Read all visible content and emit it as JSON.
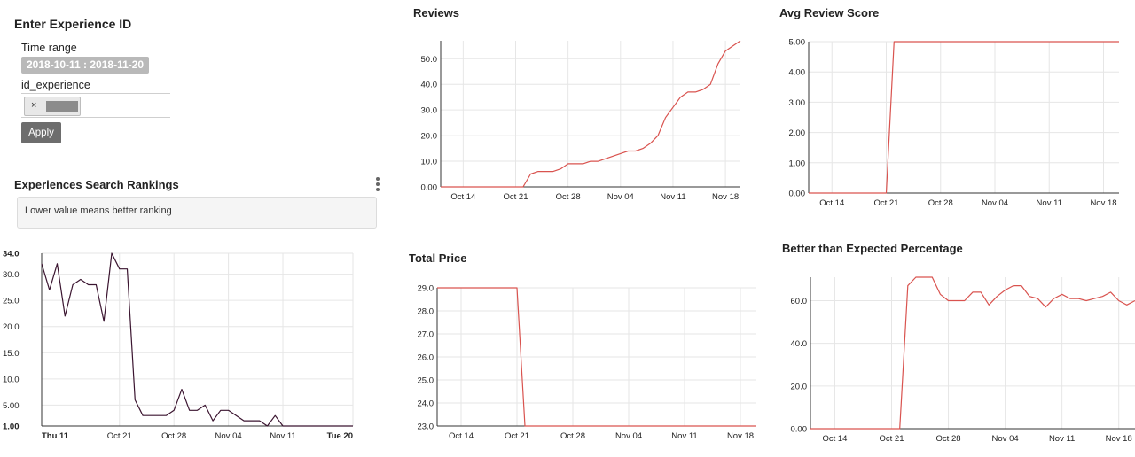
{
  "filters": {
    "title": "Enter Experience ID",
    "time_range_label": "Time range",
    "time_range_value": "2018-10-11 : 2018-11-20",
    "id_label": "id_experience",
    "tag_remove": "×",
    "apply_label": "Apply"
  },
  "rankings": {
    "title": "Experiences Search Rankings",
    "note": "Lower value means better ranking"
  },
  "titles": {
    "reviews": "Reviews",
    "avg_score": "Avg Review Score",
    "total_price": "Total Price",
    "better": "Better than Expected Percentage"
  },
  "colors": {
    "series_red": "#d9534f",
    "series_dark": "#3b1530",
    "grid": "#e6e6e6"
  },
  "chart_data": [
    {
      "id": "rankings",
      "type": "line",
      "x_ticks": [
        "Thu 11",
        "Oct 21",
        "Oct 28",
        "Nov 04",
        "Nov 11",
        "Tue 20"
      ],
      "y_ticks": [
        "1.00",
        "5.00",
        "10.0",
        "15.0",
        "20.0",
        "25.0",
        "30.0",
        "34.0"
      ],
      "ylim": [
        1,
        34
      ],
      "x": [
        "2018-10-11",
        "2018-10-12",
        "2018-10-13",
        "2018-10-14",
        "2018-10-15",
        "2018-10-16",
        "2018-10-17",
        "2018-10-18",
        "2018-10-19",
        "2018-10-20",
        "2018-10-21",
        "2018-10-22",
        "2018-10-23",
        "2018-10-24",
        "2018-10-25",
        "2018-10-26",
        "2018-10-27",
        "2018-10-28",
        "2018-10-29",
        "2018-10-30",
        "2018-10-31",
        "2018-11-01",
        "2018-11-02",
        "2018-11-03",
        "2018-11-04",
        "2018-11-05",
        "2018-11-06",
        "2018-11-07",
        "2018-11-08",
        "2018-11-09",
        "2018-11-10",
        "2018-11-11",
        "2018-11-12",
        "2018-11-13",
        "2018-11-14",
        "2018-11-15",
        "2018-11-16",
        "2018-11-17",
        "2018-11-18",
        "2018-11-19",
        "2018-11-20"
      ],
      "values": [
        32,
        27,
        32,
        22,
        28,
        29,
        28,
        28,
        21,
        34,
        31,
        31,
        6,
        3,
        3,
        3,
        3,
        4,
        8,
        4,
        4,
        5,
        2,
        4,
        4,
        3,
        2,
        2,
        2,
        1,
        3,
        1,
        1,
        1,
        1,
        1,
        1,
        1,
        1,
        1,
        1
      ],
      "color": "#3b1530"
    },
    {
      "id": "reviews",
      "type": "line",
      "x_ticks": [
        "Oct 14",
        "Oct 21",
        "Oct 28",
        "Nov 04",
        "Nov 11",
        "Nov 18"
      ],
      "y_ticks": [
        "0.00",
        "10.0",
        "20.0",
        "30.0",
        "40.0",
        "50.0"
      ],
      "ylim": [
        0,
        57
      ],
      "x": [
        "2018-10-11",
        "2018-10-12",
        "2018-10-13",
        "2018-10-14",
        "2018-10-15",
        "2018-10-16",
        "2018-10-17",
        "2018-10-18",
        "2018-10-19",
        "2018-10-20",
        "2018-10-21",
        "2018-10-22",
        "2018-10-23",
        "2018-10-24",
        "2018-10-25",
        "2018-10-26",
        "2018-10-27",
        "2018-10-28",
        "2018-10-29",
        "2018-10-30",
        "2018-10-31",
        "2018-11-01",
        "2018-11-02",
        "2018-11-03",
        "2018-11-04",
        "2018-11-05",
        "2018-11-06",
        "2018-11-07",
        "2018-11-08",
        "2018-11-09",
        "2018-11-10",
        "2018-11-11",
        "2018-11-12",
        "2018-11-13",
        "2018-11-14",
        "2018-11-15",
        "2018-11-16",
        "2018-11-17",
        "2018-11-18",
        "2018-11-19",
        "2018-11-20"
      ],
      "values": [
        0,
        0,
        0,
        0,
        0,
        0,
        0,
        0,
        0,
        0,
        0,
        0,
        5,
        6,
        6,
        6,
        7,
        9,
        9,
        9,
        10,
        10,
        11,
        12,
        13,
        14,
        14,
        15,
        17,
        20,
        27,
        31,
        35,
        37,
        37,
        38,
        40,
        48,
        53,
        55,
        57
      ],
      "color": "#d9534f"
    },
    {
      "id": "avg_score",
      "type": "line",
      "x_ticks": [
        "Oct 14",
        "Oct 21",
        "Oct 28",
        "Nov 04",
        "Nov 11",
        "Nov 18"
      ],
      "y_ticks": [
        "0.00",
        "1.00",
        "2.00",
        "3.00",
        "4.00",
        "5.00"
      ],
      "ylim": [
        0,
        5
      ],
      "x": [
        "2018-10-11",
        "2018-10-21",
        "2018-10-22",
        "2018-11-20"
      ],
      "values": [
        0,
        0,
        5,
        5
      ],
      "color": "#d9534f"
    },
    {
      "id": "total_price",
      "type": "line",
      "x_ticks": [
        "Oct 14",
        "Oct 21",
        "Oct 28",
        "Nov 04",
        "Nov 11",
        "Nov 18"
      ],
      "y_ticks": [
        "23.0",
        "24.0",
        "25.0",
        "26.0",
        "27.0",
        "28.0",
        "29.0"
      ],
      "ylim": [
        23,
        29
      ],
      "x": [
        "2018-10-11",
        "2018-10-21",
        "2018-10-22",
        "2018-11-20"
      ],
      "values": [
        29,
        29,
        23,
        23
      ],
      "color": "#d9534f"
    },
    {
      "id": "better",
      "type": "line",
      "x_ticks": [
        "Oct 14",
        "Oct 21",
        "Oct 28",
        "Nov 04",
        "Nov 11",
        "Nov 18"
      ],
      "y_ticks": [
        "0.00",
        "20.0",
        "40.0",
        "60.0"
      ],
      "ylim": [
        0,
        71
      ],
      "x": [
        "2018-10-11",
        "2018-10-22",
        "2018-10-23",
        "2018-10-24",
        "2018-10-25",
        "2018-10-26",
        "2018-10-27",
        "2018-10-28",
        "2018-10-29",
        "2018-10-30",
        "2018-10-31",
        "2018-11-01",
        "2018-11-02",
        "2018-11-03",
        "2018-11-04",
        "2018-11-05",
        "2018-11-06",
        "2018-11-07",
        "2018-11-08",
        "2018-11-09",
        "2018-11-10",
        "2018-11-11",
        "2018-11-12",
        "2018-11-13",
        "2018-11-14",
        "2018-11-15",
        "2018-11-16",
        "2018-11-17",
        "2018-11-18",
        "2018-11-19",
        "2018-11-20"
      ],
      "values": [
        0,
        0,
        67,
        71,
        71,
        71,
        63,
        60,
        60,
        60,
        64,
        64,
        58,
        62,
        65,
        67,
        67,
        62,
        61,
        57,
        61,
        63,
        61,
        61,
        60,
        61,
        62,
        64,
        60,
        58,
        60
      ],
      "color": "#d9534f"
    }
  ]
}
